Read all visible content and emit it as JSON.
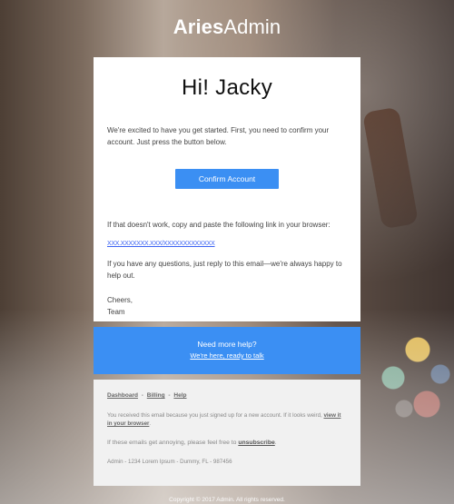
{
  "brand": {
    "bold": "Aries",
    "normal": "Admin"
  },
  "email": {
    "greeting": "Hi! Jacky",
    "intro": "We're excited to have you get started. First, you need to confirm your account. Just press the button below.",
    "confirm_button": "Confirm Account",
    "copy_text": "If that doesn't work, copy and paste the following link in your browser:",
    "link_text": "XXX.XXXXXXX.XXX/XXXXXXXXXXXXX",
    "questions": "If you have any questions, just reply to this email—we're always happy to help out.",
    "cheers": "Cheers,",
    "team": "Team"
  },
  "help": {
    "title": "Need more help?",
    "link": "We're here, ready to talk"
  },
  "footer": {
    "links": [
      "Dashboard",
      "Billing",
      "Help"
    ],
    "separator": "-",
    "notice_text": "You received this email because you just signed up for a new account. If it looks weird,",
    "notice_link": "view it in your browser",
    "notice_end": ".",
    "unsub_text": "If these emails get annoying, please feel free to",
    "unsub_link": "unsubscribe",
    "unsub_end": ".",
    "address": "Admin - 1234 Lorem Ipsum - Dummy, FL - 987456"
  },
  "copyright": "Copyright © 2017 Admin. All rights reserved.",
  "colors": {
    "accent": "#3b8ff3",
    "link": "#3b63f3"
  }
}
